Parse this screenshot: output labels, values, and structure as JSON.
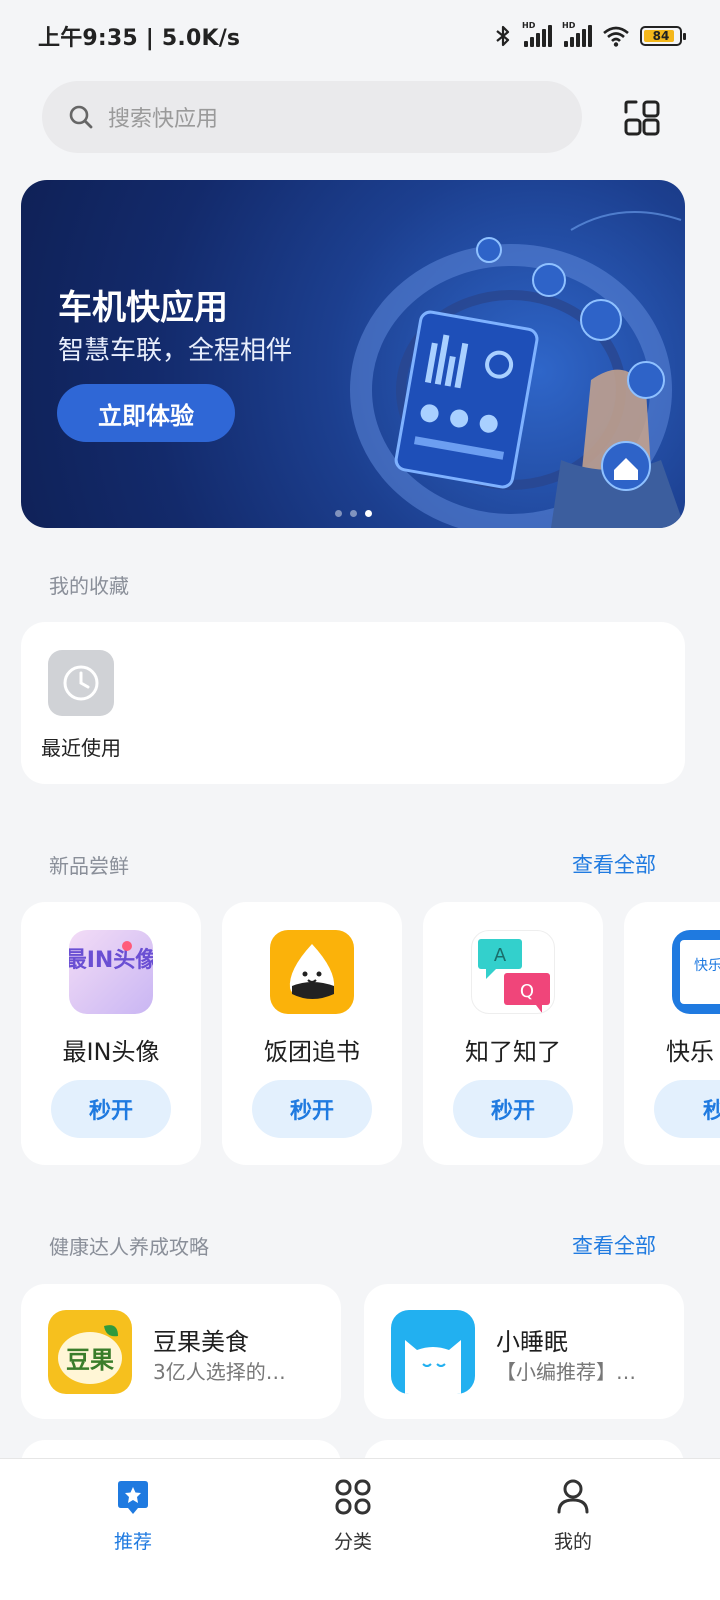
{
  "status_bar": {
    "time_speed": "上午9:35 | 5.0K/s",
    "battery": "84",
    "network_label": "HD"
  },
  "search": {
    "placeholder": "搜索快应用"
  },
  "banner": {
    "title": "车机快应用",
    "subtitle": "智慧车联，全程相伴",
    "button": "立即体验",
    "page_count": 3,
    "active_page": 3
  },
  "favorites": {
    "title": "我的收藏",
    "items": [
      {
        "label": "最近使用",
        "icon": "clock-icon"
      }
    ]
  },
  "new_apps": {
    "title": "新品尝鲜",
    "see_all": "查看全部",
    "items": [
      {
        "name": "最IN头像",
        "button": "秒开",
        "icon": "avatar-app-icon",
        "icon_text": "最IN头像"
      },
      {
        "name": "饭团追书",
        "button": "秒开",
        "icon": "rice-ball-icon"
      },
      {
        "name": "知了知了",
        "button": "秒开",
        "icon": "qa-chat-icon",
        "icon_text": [
          "A",
          "Q"
        ]
      },
      {
        "name": "快乐",
        "button": "秒",
        "icon": "book-icon",
        "icon_text": "快乐"
      }
    ]
  },
  "health": {
    "title": "健康达人养成攻略",
    "see_all": "查看全部",
    "items": [
      {
        "name": "豆果美食",
        "desc": "3亿人选择的…",
        "icon": "douguo-icon",
        "icon_text": "豆果"
      },
      {
        "name": "小睡眠",
        "desc": "【小编推荐】…",
        "icon": "sleep-cat-icon"
      }
    ]
  },
  "bottom_nav": {
    "items": [
      {
        "label": "推荐",
        "icon": "star-tag-icon",
        "active": true
      },
      {
        "label": "分类",
        "icon": "grid-icon",
        "active": false
      },
      {
        "label": "我的",
        "icon": "person-icon",
        "active": false
      }
    ]
  },
  "colors": {
    "accent": "#1f7ae0",
    "banner_bg": "#1c3f8f",
    "button_bg": "#e3f0fd",
    "page_bg": "#f4f5f7"
  }
}
